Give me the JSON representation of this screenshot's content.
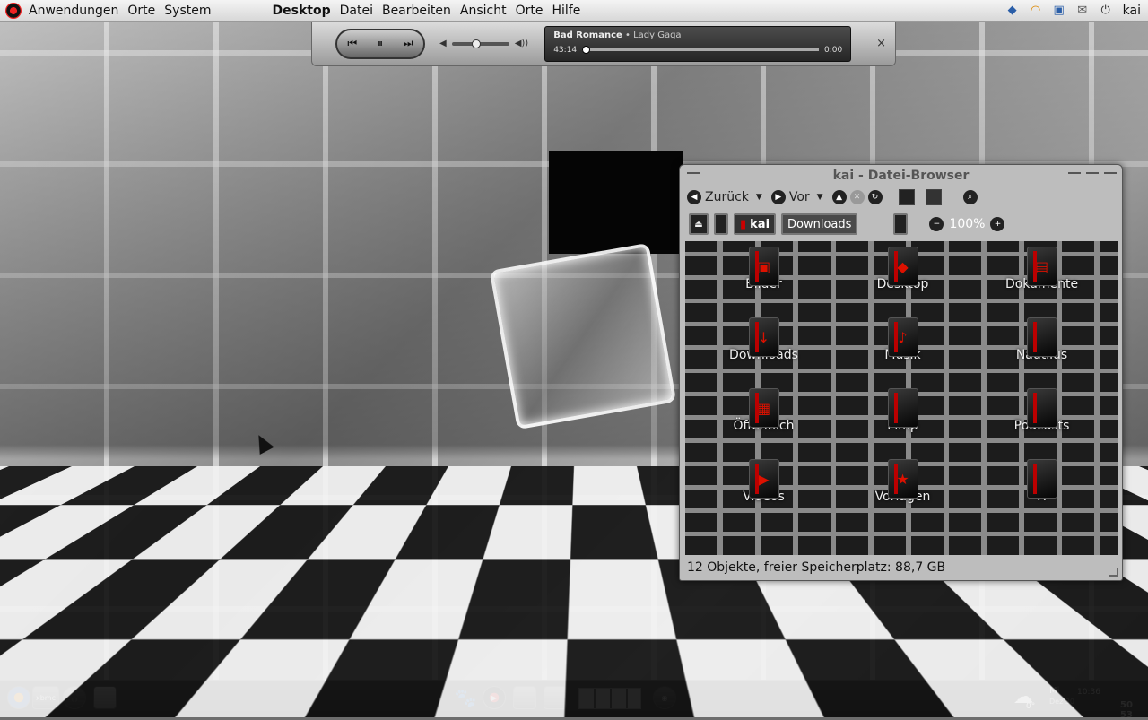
{
  "top_panel": {
    "menu": [
      "Anwendungen",
      "Orte",
      "System"
    ],
    "app_menu": [
      "Desktop",
      "Datei",
      "Bearbeiten",
      "Ansicht",
      "Orte",
      "Hilfe"
    ],
    "user": "kai"
  },
  "player": {
    "title": "Bad Romance",
    "separator": "•",
    "artist": "Lady Gaga",
    "elapsed": "43:14",
    "remaining": "0:00",
    "close": "×"
  },
  "file_browser": {
    "title": "kai - Datei-Browser",
    "back_label": "Zurück",
    "forward_label": "Vor",
    "crumb_home": "kai",
    "crumb_current": "Downloads",
    "zoom": "100%",
    "items": [
      "Bilder",
      "Desktop",
      "Dokumente",
      "Downloads",
      "Musik",
      "Nautilus",
      "Öffentlich",
      "Pimp",
      "Podcasts",
      "Videos",
      "Vorlagen",
      "X"
    ],
    "status": "12 Objekte, freier Speicherplatz: 88,7 GB"
  },
  "bottom_panel": {
    "launchers": [
      "firefox-icon",
      "xbmc-icon",
      "headphones-icon",
      "drive-icon"
    ],
    "xbmc_label": "xbmc",
    "weather_temp": "0°",
    "clock_day": "Mi",
    "clock_date": "Dez 30",
    "clock_time": "10:36",
    "clock_seconds": "50 53"
  }
}
